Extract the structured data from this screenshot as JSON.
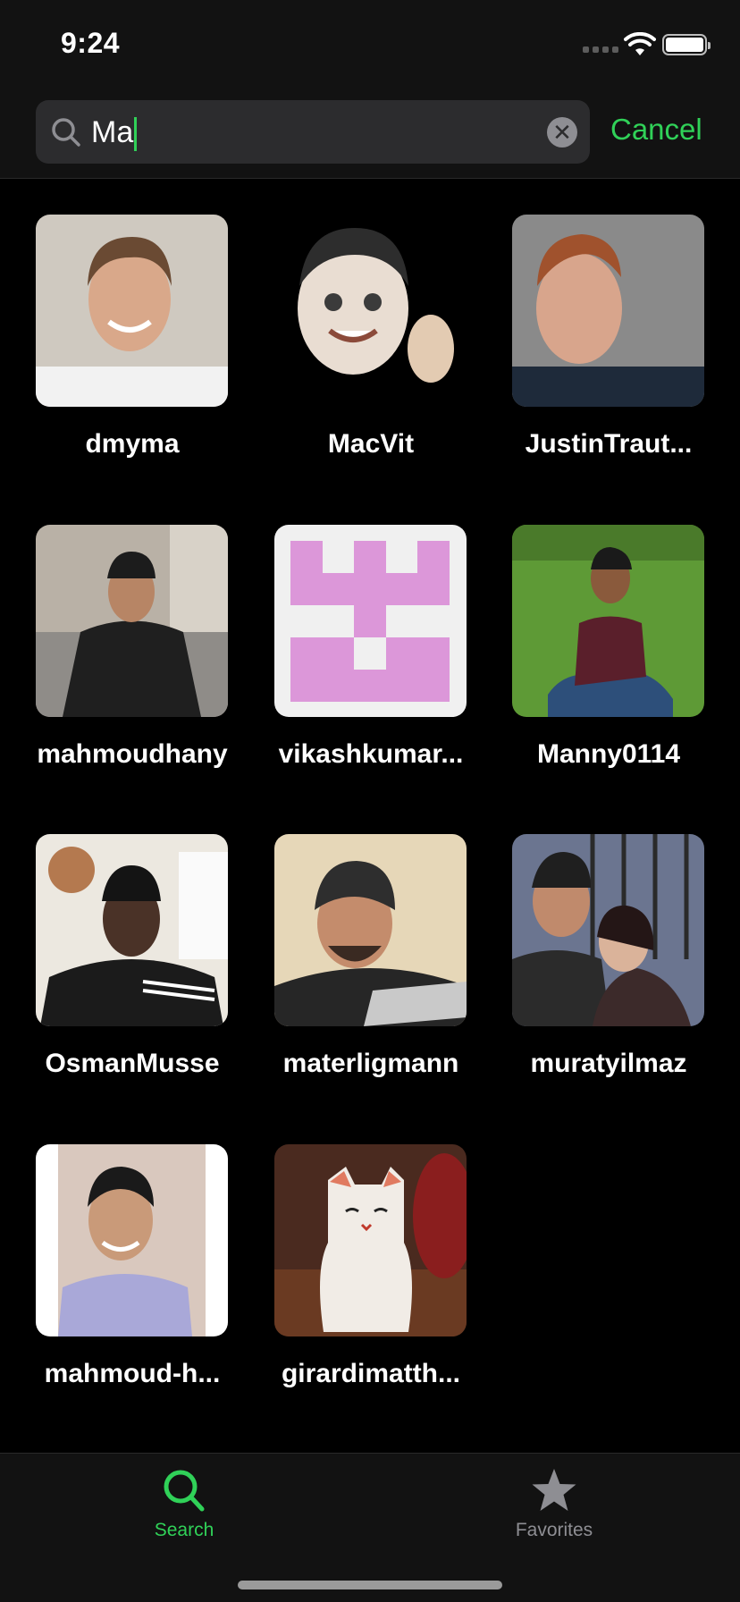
{
  "status_bar": {
    "time": "9:24"
  },
  "search": {
    "value": "Ma",
    "cancel_label": "Cancel"
  },
  "users": [
    {
      "name": "dmyma"
    },
    {
      "name": "MacVit"
    },
    {
      "name": "JustinTraut..."
    },
    {
      "name": "mahmoudhany"
    },
    {
      "name": "vikashkumar..."
    },
    {
      "name": "Manny0114"
    },
    {
      "name": "OsmanMusse"
    },
    {
      "name": "materligmann"
    },
    {
      "name": "muratyilmaz"
    },
    {
      "name": "mahmoud-h..."
    },
    {
      "name": "girardimatth..."
    }
  ],
  "tabs": [
    {
      "label": "Search",
      "icon": "magnifier-icon",
      "active": true
    },
    {
      "label": "Favorites",
      "icon": "star-icon",
      "active": false
    }
  ],
  "colors": {
    "accent": "#30d158",
    "inactive": "#8e8e93",
    "identicon": "#dc97d9"
  }
}
